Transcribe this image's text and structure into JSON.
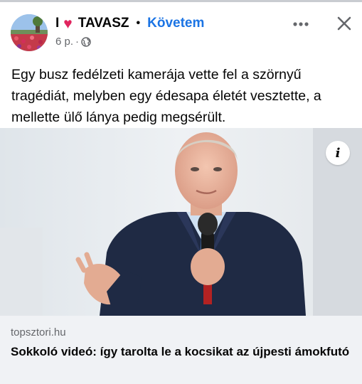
{
  "post": {
    "page_name_prefix": "I",
    "page_name_heart": "♥",
    "page_name": "TAVASZ",
    "separator": "•",
    "follow_label": "Követem",
    "time_ago": "6 p.",
    "meta_separator": "·",
    "audience_icon": "globe-icon",
    "more_icon": "more-horizontal-icon",
    "close_icon": "close-icon",
    "text": "Egy busz fedélzeti kamerája vette fel a szörnyű tragédiát, melyben egy édesapa életét vesztette, a mellette ülő lánya pedig megsérült."
  },
  "link_preview": {
    "info_icon": "info-icon",
    "info_glyph": "i",
    "domain": "topsztori.hu",
    "headline": "Sokkoló videó: így tarolta le a kocsikat az újpesti ámokfutó"
  },
  "colors": {
    "accent": "#1b74e4",
    "heart": "#e0245e",
    "footer_bg": "#f0f2f5",
    "meta_text": "#65676b"
  }
}
